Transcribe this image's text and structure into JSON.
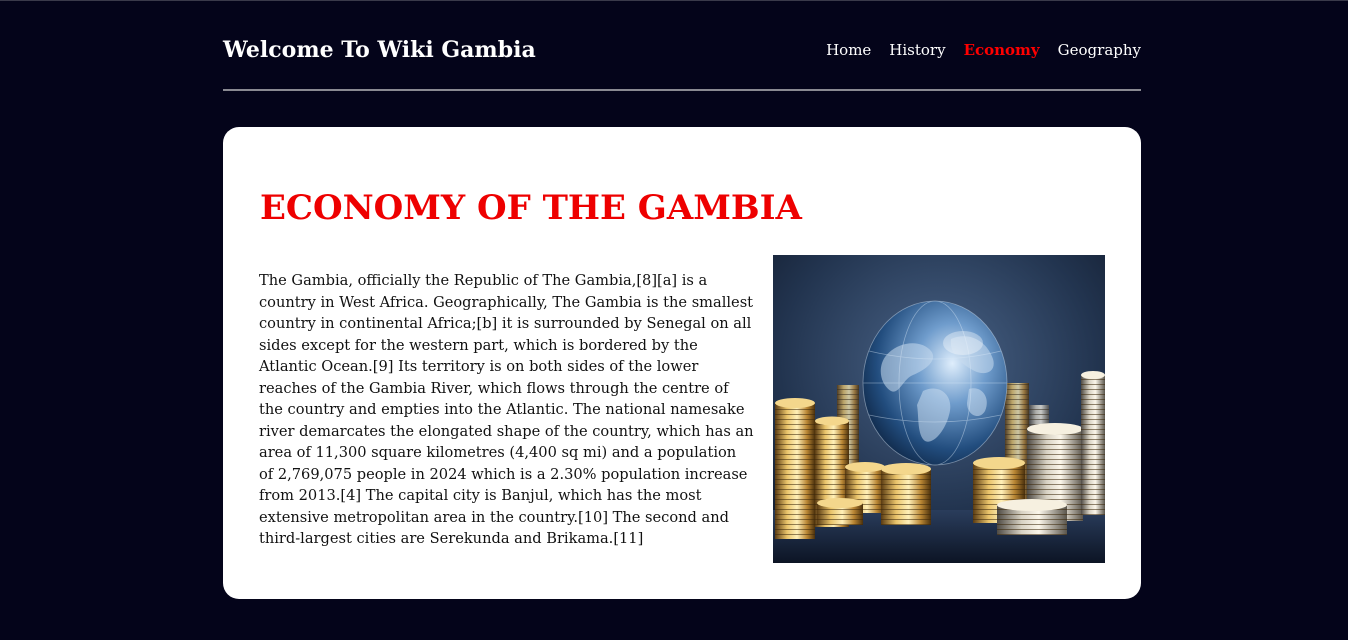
{
  "header": {
    "site_title": "Welcome To Wiki Gambia",
    "nav": {
      "home": "Home",
      "history": "History",
      "economy": "Economy",
      "geography": "Geography",
      "active": "economy"
    }
  },
  "main": {
    "title": "ECONOMY OF THE GAMBIA",
    "paragraph": "The Gambia, officially the Republic of The Gambia,[8][a] is a country in West Africa. Geographically, The Gambia is the smallest country in continental Africa;[b] it is surrounded by Senegal on all sides except for the western part, which is bordered by the Atlantic Ocean.[9] Its territory is on both sides of the lower reaches of the Gambia River, which flows through the centre of the country and empties into the Atlantic. The national namesake river demarcates the elongated shape of the country, which has an area of 11,300 square kilometres (4,400 sq mi) and a population of 2,769,075 people in 2024 which is a 2.30% population increase from 2013.[4] The capital city is Banjul, which has the most extensive metropolitan area in the country.[10] The second and third-largest cities are Serekunda and Brikama.[11]",
    "image_subject": "glass globe among stacks of gold coins"
  },
  "colors": {
    "page_background": "#04041a",
    "accent": "#ff0000",
    "card_background": "#ffffff"
  }
}
